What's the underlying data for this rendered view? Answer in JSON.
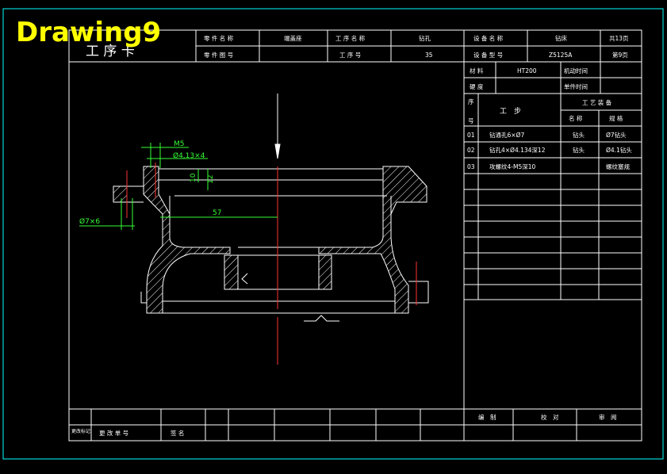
{
  "overlay_title": "Drawing9",
  "header": {
    "card_title": "工 序 卡",
    "part_name_label": "零 件 名 称",
    "part_name_value": "端盖座",
    "part_no_label": "零 件 图 号",
    "part_no_value": "",
    "process_name_label": "工 序 名 称",
    "process_name_value": "钻孔",
    "process_no_label": "工 序 号",
    "process_no_value": "35",
    "equip_name_label": "设 备 名 称",
    "equip_name_value": "钻床",
    "equip_model_label": "设 备 型 号",
    "equip_model_value": "Z5125A",
    "total_pages": "共13页",
    "page_no": "第9页"
  },
  "info": {
    "material_label": "材 料",
    "material_value": "HT200",
    "machine_time_label": "机动时间",
    "hardness_label": "硬 度",
    "unit_time_label": "单件时间"
  },
  "steps": {
    "seq_label_1": "序",
    "seq_label_2": "号",
    "step_label": "工　步",
    "equipment_label": "工 艺 装 备",
    "name_label": "名 称",
    "spec_label": "规 格",
    "rows": [
      {
        "no": "01",
        "desc": "钻通孔6×Ø7",
        "name": "钻头",
        "spec": "Ø7钻头"
      },
      {
        "no": "02",
        "desc": "钻孔4×Ø4.134深12",
        "name": "钻头",
        "spec": "Ø4.1钻头"
      },
      {
        "no": "03",
        "desc": "攻螺纹4-M5深10",
        "name": "",
        "spec": "螺纹塞规"
      }
    ]
  },
  "footer": {
    "change_mark": "更改标记",
    "change_doc": "更 改 单 号",
    "signature": "签 名",
    "compile": "编　制",
    "check": "校　对",
    "review": "审　阅"
  },
  "dimensions": {
    "thread": "M5",
    "hole_413": "Ø4,13×4",
    "hole_7": "Ø7×6",
    "dim_10": "10",
    "dim_12": "12",
    "dim_57": "57"
  },
  "colors": {
    "frame": "#00ffff",
    "lines": "#ffffff",
    "dims": "#33ff33",
    "center": "#ff3333",
    "overlay": "#ffff00"
  }
}
